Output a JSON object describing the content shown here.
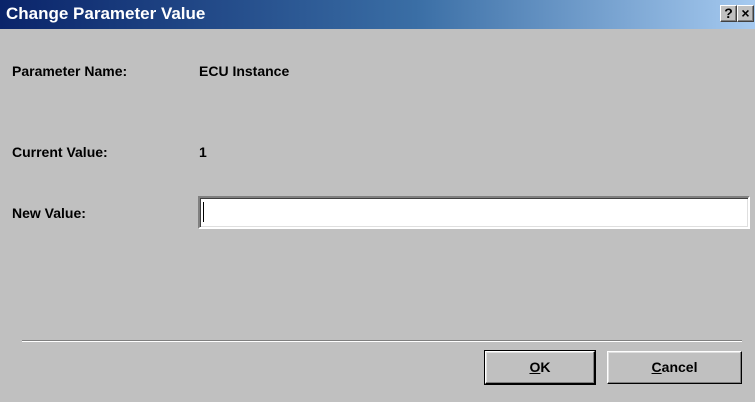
{
  "window": {
    "title": "Change Parameter Value",
    "help_button": "?",
    "close_button": "×"
  },
  "fields": {
    "parameter_name_label": "Parameter Name:",
    "parameter_name_value": "ECU Instance",
    "current_value_label": "Current Value:",
    "current_value_value": "1",
    "new_value_label": "New Value:",
    "new_value_input": ""
  },
  "buttons": {
    "ok_accel": "O",
    "ok_rest": "K",
    "cancel_accel": "C",
    "cancel_rest": "ancel"
  },
  "colors": {
    "titlebar_start": "#0a246a",
    "titlebar_end": "#a6caf0",
    "dialog_face": "#c0c0c0"
  }
}
